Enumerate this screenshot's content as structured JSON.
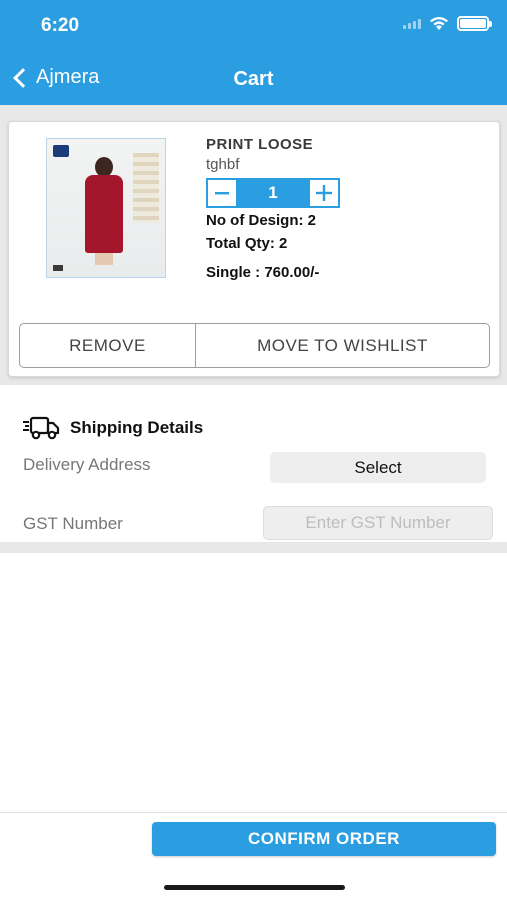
{
  "status_bar": {
    "time": "6:20"
  },
  "nav": {
    "back_label": "Ajmera",
    "title": "Cart"
  },
  "colors": {
    "accent": "#2a9ee0",
    "gray_band": "#e8e8e8"
  },
  "cart_item": {
    "image_icon": "product-image",
    "name": "PRINT LOOSE",
    "subtitle": "tghbf",
    "quantity": "1",
    "no_of_design": "No of Design: 2",
    "total_qty": "Total Qty: 2",
    "single_price": "Single : 760.00/-",
    "remove_label": "REMOVE",
    "wishlist_label": "MOVE TO WISHLIST"
  },
  "shipping": {
    "icon": "truck-icon",
    "title": "Shipping Details",
    "delivery_label": "Delivery Address",
    "select_label": "Select",
    "gst_label": "GST Number",
    "gst_placeholder": "Enter GST Number"
  },
  "footer": {
    "confirm_label": "CONFIRM ORDER"
  }
}
